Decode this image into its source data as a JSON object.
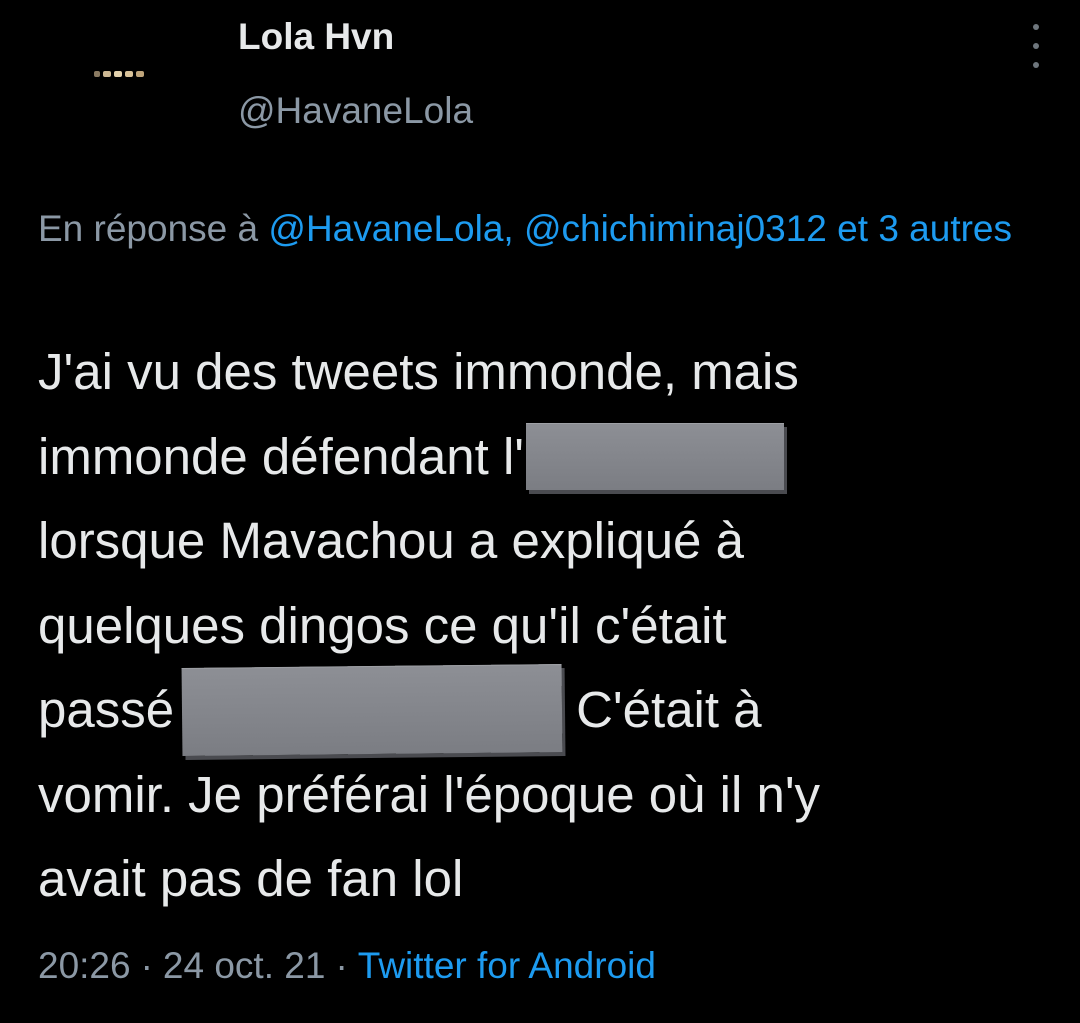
{
  "tweet": {
    "author": {
      "display_name": "Lola Hvn",
      "handle": "@HavaneLola"
    },
    "reply_to": {
      "prefix": "En réponse à",
      "mentions": [
        "@HavaneLola,",
        "@chichiminaj0312"
      ],
      "suffix_word": "et",
      "others": "3 autres"
    },
    "text_lines": [
      [
        "J'ai vu des tweets immonde, mais"
      ],
      [
        "immonde défendant l'"
      ],
      [
        "lorsque Mavachou a expliqué à"
      ],
      [
        "quelques dingos ce qu'il c'était"
      ],
      [
        "passé",
        "C'était à"
      ],
      [
        "vomir. Je préférai l'époque où il n'y"
      ],
      [
        "avait pas de fan lol"
      ]
    ],
    "time": "20:26",
    "date": "24 oct. 21",
    "separator": "·",
    "source": "Twitter for Android"
  },
  "colors": {
    "background": "#000000",
    "text": "#e7e9ea",
    "secondary": "#8b98a5",
    "link": "#1d9bf0",
    "redaction": "#818389"
  },
  "icons": {
    "more": "vertical-ellipsis-icon"
  }
}
